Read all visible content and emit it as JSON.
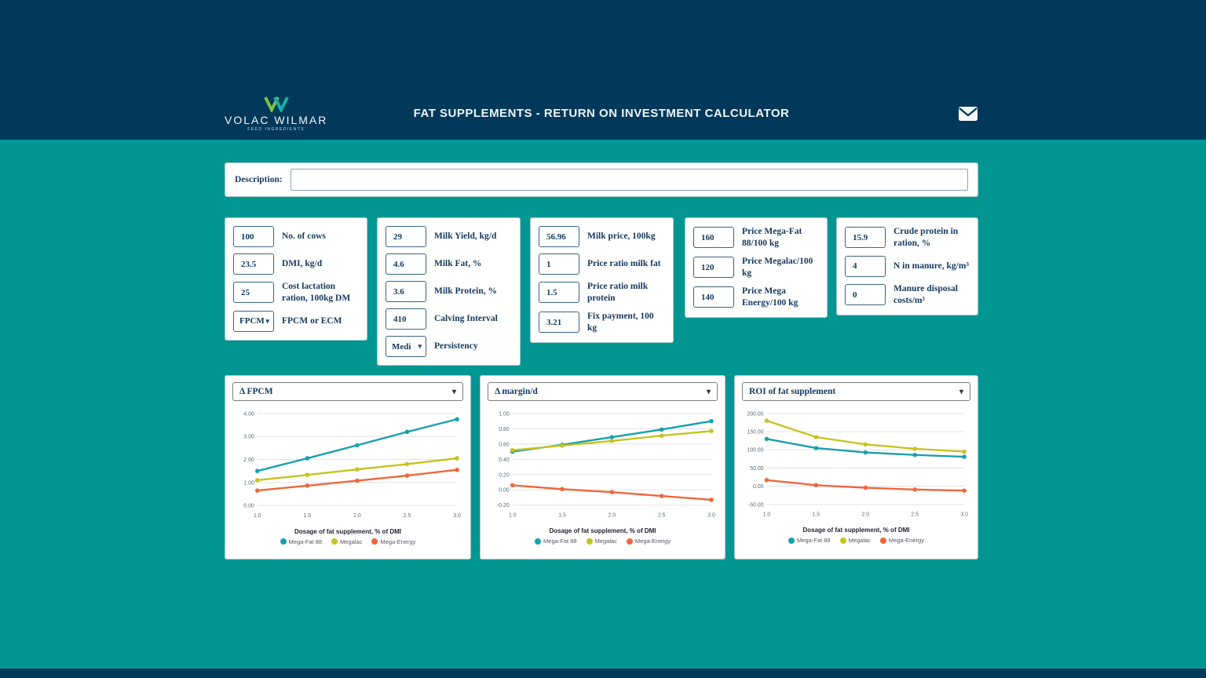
{
  "header": {
    "logo_title": "VOLAC WILMAR",
    "logo_subtitle": "FEED INGREDIENTS",
    "title": "FAT SUPPLEMENTS - RETURN ON INVESTMENT CALCULATOR"
  },
  "description": {
    "label": "Description:",
    "value": ""
  },
  "panels": [
    {
      "fields": [
        {
          "value": "100",
          "label": "No. of cows"
        },
        {
          "value": "23.5",
          "label": "DMI, kg/d"
        },
        {
          "value": "25",
          "label": "Cost lactation ration, 100kg DM"
        },
        {
          "value": "FPCM",
          "label": "FPCM or ECM",
          "control": "select"
        }
      ]
    },
    {
      "fields": [
        {
          "value": "29",
          "label": "Milk Yield, kg/d"
        },
        {
          "value": "4.6",
          "label": "Milk Fat, %"
        },
        {
          "value": "3.6",
          "label": "Milk Protein, %"
        },
        {
          "value": "410",
          "label": "Calving Interval"
        },
        {
          "value": "Medi",
          "label": "Persistency",
          "control": "select"
        }
      ]
    },
    {
      "fields": [
        {
          "value": "56.96",
          "label": "Milk price, 100kg"
        },
        {
          "value": "1",
          "label": "Price ratio milk fat"
        },
        {
          "value": "1.5",
          "label": "Price ratio milk protein"
        },
        {
          "value": "3.21",
          "label": "Fix payment, 100 kg"
        }
      ]
    },
    {
      "fields": [
        {
          "value": "160",
          "label": "Price Mega-Fat 88/100 kg"
        },
        {
          "value": "120",
          "label": "Price Megalac/100 kg"
        },
        {
          "value": "140",
          "label": "Price Mega Energy/100 kg"
        }
      ]
    },
    {
      "fields": [
        {
          "value": "15.9",
          "label": "Crude protein in ration, %"
        },
        {
          "value": "4",
          "label": "N in manure, kg/m³"
        },
        {
          "value": "0",
          "label": "Manure disposal costs/m³"
        }
      ]
    }
  ],
  "chart_data": [
    {
      "type": "line",
      "title": "Δ FPCM",
      "x": [
        1.0,
        1.5,
        2.0,
        2.5,
        3.0
      ],
      "xlabel": "Dosage of fat supplement, % of DMI",
      "ylim": [
        0,
        4
      ],
      "yticks": [
        4,
        3,
        2,
        1,
        0
      ],
      "grid": true,
      "legend_position": "bottom",
      "series": [
        {
          "name": "Mega-Fat 88",
          "color": "#17a0ad",
          "values": [
            1.5,
            2.05,
            2.62,
            3.2,
            3.75
          ]
        },
        {
          "name": "Megalac",
          "color": "#c6c31f",
          "values": [
            1.1,
            1.33,
            1.57,
            1.8,
            2.05
          ]
        },
        {
          "name": "Mega-Energy",
          "color": "#f0653a",
          "values": [
            0.65,
            0.86,
            1.08,
            1.3,
            1.55
          ]
        }
      ]
    },
    {
      "type": "line",
      "title": "Δ margin/d",
      "x": [
        1.0,
        1.5,
        2.0,
        2.5,
        3.0
      ],
      "xlabel": "Dosage of fat supplement, % of DMI",
      "ylim": [
        -0.2,
        1.0
      ],
      "yticks": [
        1.0,
        0.8,
        0.6,
        0.4,
        0.2,
        0.0,
        -0.2
      ],
      "grid": true,
      "legend_position": "bottom",
      "series": [
        {
          "name": "Mega-Fat 88",
          "color": "#17a0ad",
          "values": [
            0.5,
            0.59,
            0.69,
            0.79,
            0.9
          ]
        },
        {
          "name": "Megalac",
          "color": "#c6c31f",
          "values": [
            0.52,
            0.58,
            0.64,
            0.71,
            0.77
          ]
        },
        {
          "name": "Mega-Energy",
          "color": "#f0653a",
          "values": [
            0.06,
            0.01,
            -0.03,
            -0.08,
            -0.13
          ]
        }
      ]
    },
    {
      "type": "line",
      "title": "ROI of fat supplement",
      "x": [
        1.0,
        1.5,
        2.0,
        2.5,
        3.0
      ],
      "xlabel": "Dosage of fat supplement, % of DMI",
      "ylim": [
        -50,
        200
      ],
      "yticks": [
        200,
        150,
        100,
        50,
        0,
        -50
      ],
      "grid": true,
      "legend_position": "bottom",
      "series": [
        {
          "name": "Mega-Fat 88",
          "color": "#17a0ad",
          "values": [
            130,
            105,
            93,
            86,
            81
          ]
        },
        {
          "name": "Megalac",
          "color": "#c6c31f",
          "values": [
            180,
            135,
            115,
            103,
            95
          ]
        },
        {
          "name": "Mega-Energy",
          "color": "#f0653a",
          "values": [
            17,
            3,
            -4,
            -9,
            -12
          ]
        }
      ]
    }
  ],
  "colors": {
    "header_navy": "#02395a",
    "body_teal": "#029692",
    "series_teal": "#17a0ad",
    "series_olive": "#c6c31f",
    "series_orange": "#f0653a",
    "text_navy": "#14395c"
  }
}
